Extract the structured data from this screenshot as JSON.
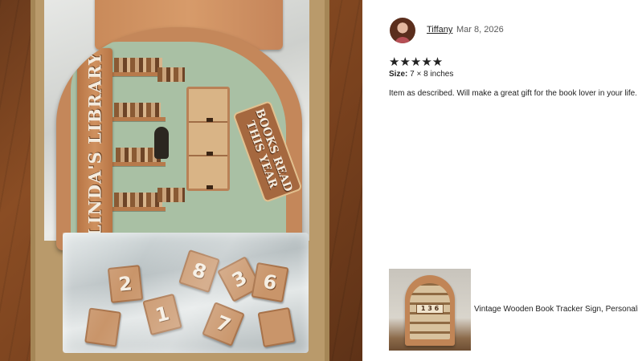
{
  "photo": {
    "sign_name": "LINDA'S LIBRARY",
    "sign_banner": "BOOKS READ\nTHIS YEAR",
    "number_tiles": [
      "2",
      "8",
      "3",
      "6",
      "1",
      "7"
    ]
  },
  "review": {
    "reviewer_name": "Tiffany",
    "date": "Mar 8, 2026",
    "rating": 5,
    "stars": "★★★★★",
    "size_label": "Size:",
    "size_value": "7 × 8 inches",
    "text": "Item as described. Will make a great gift for the book lover in your life.",
    "thumbnail_digits": "1 3 6",
    "item_caption": "Vintage Wooden Book Tracker Sign, Personaliz"
  },
  "colors": {
    "text": "#222222",
    "muted": "#595959",
    "wood": "#c4875a",
    "sage": "#a9c0a4"
  },
  "icons": {
    "rating": "star-icon"
  }
}
